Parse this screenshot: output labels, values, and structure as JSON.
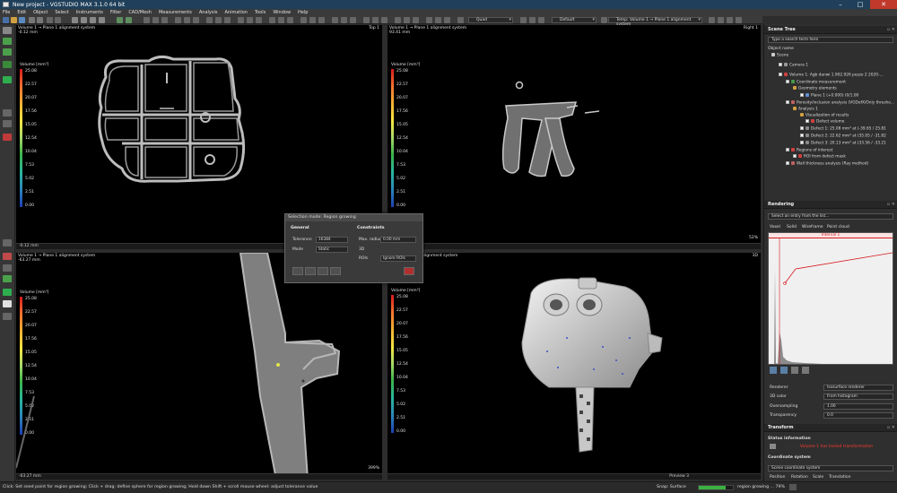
{
  "app": {
    "title": "New project - VGSTUDIO MAX 3.1.0 64 bit",
    "menu": [
      "File",
      "Edit",
      "Object",
      "Select",
      "Instruments",
      "Filter",
      "CAD/Mesh",
      "Measurements",
      "Analysis",
      "Animation",
      "Tools",
      "Window",
      "Help"
    ]
  },
  "toolbar": {
    "quality": "Quad",
    "render_preset": "Default",
    "coord_system": "Temp: Volume 1 → Plane 1 alignment system"
  },
  "viewports": {
    "top": {
      "header1": "Volume 1 → Plane 1 alignment system",
      "header2": "-0.12 mm",
      "corner": "Top 1",
      "footer": "-0.12 mm"
    },
    "right": {
      "header1": "Volume 1 → Plane 1 alignment system",
      "header2": "93.41 mm",
      "corner": "Right 1",
      "zoom": "52%"
    },
    "front": {
      "header1": "Volume 1 → Plane 1 alignment system",
      "header2": "-63.27 mm",
      "footer": "-63.27 mm",
      "zoom": "399%"
    },
    "view3d": {
      "header1": "alignment system",
      "corner": "3D",
      "footer": "Preview 3"
    },
    "legend": {
      "title": "Volume [mm³]",
      "ticks": [
        "25.08",
        "22.57",
        "20.07",
        "17.56",
        "15.05",
        "12.54",
        "10.04",
        "7.53",
        "5.02",
        "2.51",
        "0.00"
      ]
    }
  },
  "dialog": {
    "title": "Selection mode: Region growing",
    "general": "General",
    "constraints": "Constraints",
    "tolerance_label": "Tolerance:",
    "tolerance_value": "16384",
    "mode_label": "Mode",
    "mode_value": "Static",
    "max_radius_label": "Max. radius",
    "max_radius_value": "0.00 mm",
    "three_d_label": "3D",
    "rois_label": "ROIs",
    "rois_value": "Ignore ROIs"
  },
  "scene_tree": {
    "title": "Scene Tree",
    "search_placeholder": "Type a search term here",
    "col_header": "Object name",
    "items": [
      "Scene",
      "Camera 1",
      "Volume 1: Agb danwi 1.902.926 pezzo 2 2020-...",
      "Coordinate measurement",
      "Geometry elements",
      "Plane 1 (+0.000) (0/1.00",
      "Porosity/inclusion analysis (VGDefX/Only thresho...",
      "Analysis 1",
      "Visualization of results",
      "Defect volume",
      "Defect 1: 25.08 mm³ at (-39.65 / 25.81",
      "Defect 2: 22.62 mm³ at (35.05 / -31.82",
      "Defect 3: 20.13 mm³ at (33.56 / -33.21",
      "Regions of interest",
      "ROI from defect mask",
      "Wall thickness analysis (Ray method)"
    ]
  },
  "rendering": {
    "title": "Rendering",
    "select_placeholder": "Select an entry from the list...",
    "tabs": [
      "Voxel",
      "Solid",
      "Wireframe",
      "Point cloud"
    ],
    "interval_label": "Interval 1",
    "renderer_label": "Renderer",
    "renderer_value": "Isosurface renderer",
    "color3d_label": "3D color",
    "color3d_value": "From histogram",
    "oversampling_label": "Oversampling",
    "oversampling_value": "1.00",
    "transparency_label": "Transparency",
    "transparency_value": "0.0"
  },
  "transform": {
    "title": "Transform",
    "status_label": "Status information",
    "status_value": "Volume 1 has locked transformation",
    "coord_label": "Coordinate system",
    "coord_value": "Scene coordinate system",
    "tabs": [
      "Position",
      "Rotation",
      "Scale",
      "Translation"
    ]
  },
  "status": {
    "hint": "Click: Set seed point for region growing; Click + drag: define sphere for region growing; Hold down Shift + scroll mouse wheel: adjust tolerance value",
    "snap": "Snap: Surface",
    "progress_text": "region growing ... 79%",
    "progress": 0.79
  },
  "colors": {
    "accent_red": "#d7191c",
    "histogram_fill": "#d0d0d0",
    "selection_blue": "#1c3fb5",
    "status_text_red": "#ff3b2f"
  }
}
